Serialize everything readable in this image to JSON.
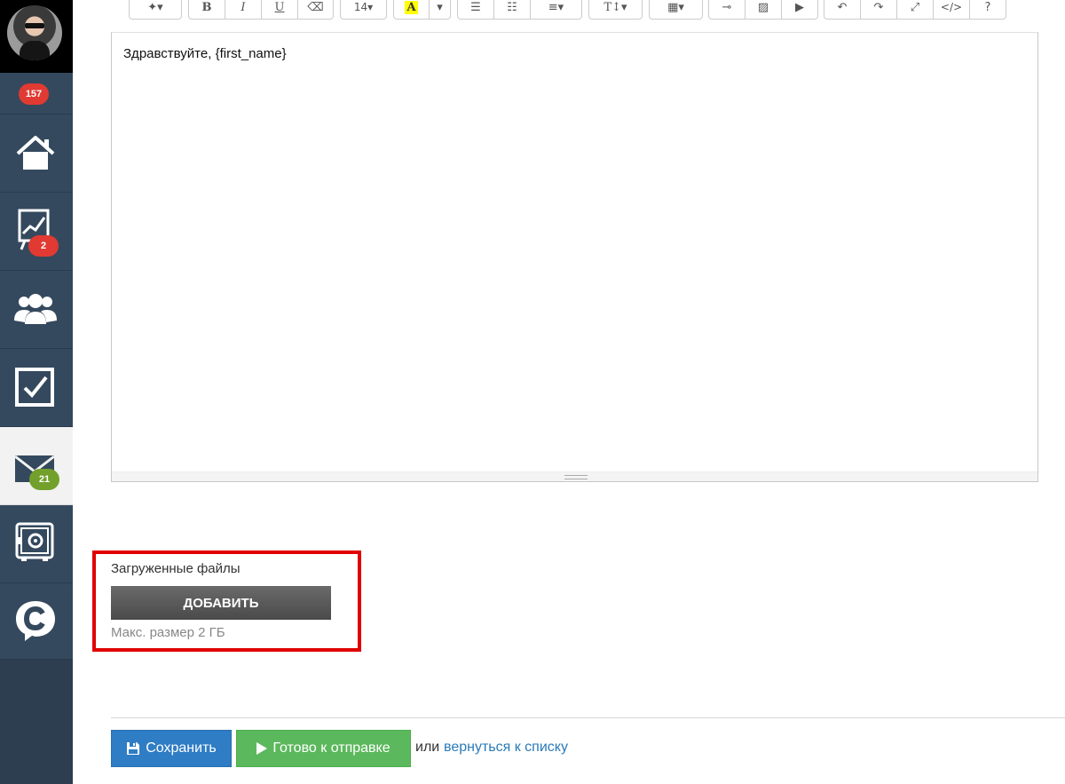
{
  "sidebar": {
    "notifications_badge": "157",
    "analytics_badge": "2",
    "mail_badge": "21",
    "colors": {
      "bg": "#34495e",
      "active_bg": "#f2f2f2",
      "badge_red": "#e03a32",
      "badge_green": "#72a02b"
    }
  },
  "toolbar": {
    "font_size": "14",
    "icons": [
      "magic-wand-icon",
      "bold-icon",
      "italic-icon",
      "underline-icon",
      "eraser-icon",
      "font-size-dropdown",
      "font-color-icon",
      "color-caret-icon",
      "unordered-list-icon",
      "ordered-list-icon",
      "align-icon",
      "line-height-icon",
      "table-icon",
      "link-icon",
      "image-icon",
      "video-icon",
      "undo-icon",
      "redo-icon",
      "fullscreen-icon",
      "code-view-icon",
      "help-icon"
    ]
  },
  "editor": {
    "content": "Здравствуйте, {first_name}"
  },
  "files": {
    "title": "Загруженные файлы",
    "add_label": "ДОБАВИТЬ",
    "max_size": "Макс. размер 2 ГБ"
  },
  "footer": {
    "save_label": "Сохранить",
    "ready_label": "Готово к отправке",
    "or_text": "или",
    "back_link": "вернуться к списку",
    "colors": {
      "save": "#2f7dc4",
      "ready": "#5cb85c",
      "link": "#2a7ab8",
      "highlight_border": "#e00000"
    }
  }
}
